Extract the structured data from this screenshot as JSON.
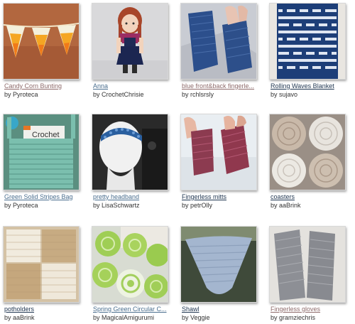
{
  "items": [
    {
      "title": "Candy Corn Bunting",
      "by_prefix": "by",
      "author": "Pyroteca"
    },
    {
      "title": "Anna",
      "by_prefix": "by",
      "author": "CrochetChrisie"
    },
    {
      "title": "blue front&back fingerle...",
      "by_prefix": "by",
      "author": "rchlsrsly"
    },
    {
      "title": "Rolling Waves Blanket",
      "by_prefix": "by",
      "author": "sujavo"
    },
    {
      "title": "Green Solid Stripes Bag",
      "by_prefix": "by",
      "author": "Pyroteca",
      "image_text": "Crochet"
    },
    {
      "title": "pretty headband",
      "by_prefix": "by",
      "author": "LisaSchwartz"
    },
    {
      "title": "Fingerless mitts",
      "by_prefix": "by",
      "author": "petrOlly"
    },
    {
      "title": "coasters",
      "by_prefix": "by",
      "author": "aaBrink"
    },
    {
      "title": "potholders",
      "by_prefix": "by",
      "author": "aaBrink"
    },
    {
      "title": "Spring Green Circular C...",
      "by_prefix": "by",
      "author": "MagicalAmigurumi"
    },
    {
      "title": "Shawl",
      "by_prefix": "by",
      "author": "Veggie"
    },
    {
      "title": "Fingerless gloves",
      "by_prefix": "by",
      "author": "gramziechris"
    }
  ]
}
